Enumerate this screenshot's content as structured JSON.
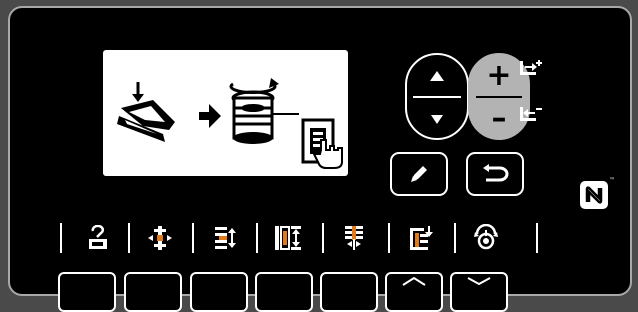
{
  "screen": {
    "illustration": "pedal-to-bobbin-winder-illustration",
    "hand_icon": "bobbin-winder-touch-icon"
  },
  "adjust": {
    "up_icon": "triangle-up-icon",
    "down_icon": "triangle-down-icon",
    "plus_label": "+",
    "minus_label": "–",
    "increase_side_icon": "winding-increase-icon",
    "decrease_side_icon": "winding-decrease-icon"
  },
  "actions": {
    "edit_icon": "pencil-icon",
    "return_icon": "return-arrow-icon"
  },
  "nfc": {
    "icon": "nfc-icon",
    "tm": "™"
  },
  "toolbar": {
    "items": [
      {
        "name": "bobbin-winder-mode",
        "icon": "bobbin-winder-icon"
      },
      {
        "name": "needle-center",
        "icon": "needle-center-icon"
      },
      {
        "name": "needle-right-shift",
        "icon": "needle-right-icon"
      },
      {
        "name": "stitch-width",
        "icon": "stitch-width-icon"
      },
      {
        "name": "thread-tension",
        "icon": "thread-tension-icon"
      },
      {
        "name": "feed-pitch",
        "icon": "feed-pitch-icon"
      },
      {
        "name": "presser-pressure",
        "icon": "presser-pressure-icon"
      }
    ]
  },
  "colors": {
    "panel": "#000000",
    "border": "#a8a8a8",
    "accent_orange": "#e07a1a",
    "highlight_gray": "#b3b3b3"
  }
}
